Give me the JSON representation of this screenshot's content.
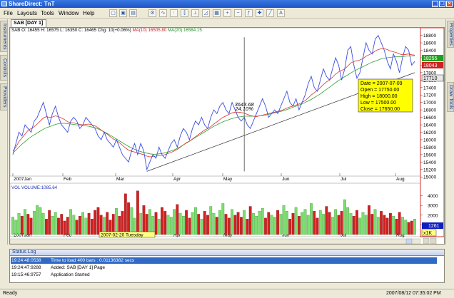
{
  "window": {
    "title": "ShareDirect: TnT"
  },
  "menu": [
    "File",
    "Layouts",
    "Tools",
    "Window",
    "Help"
  ],
  "left_tabs": [
    "Instruments",
    "Controls",
    "Providers"
  ],
  "right_tabs": [
    "Properties",
    "Draw Tools"
  ],
  "doc_tab": "SAB [DAY 1]",
  "price_header": {
    "ohlc": "SAB O: 16455 H: 16575 L: 16350 C: 16465 Chg: 10(+0.06%)",
    "ma10": "MA(10) 16505.80",
    "ma20": "MA(20) 16584.15"
  },
  "volume_header": "VOL VOLUME:1085.64",
  "annotation": {
    "points": "3643.68",
    "percent": "24.10%"
  },
  "tooltip": {
    "date": "Date = 2007-07-09",
    "open": "Open = 17750.00",
    "high": "High = 18000.00",
    "low": "Low = 17500.00",
    "close": "Close = 17650.00"
  },
  "price_badges": {
    "a": "18255",
    "b": "18043",
    "c": "17710"
  },
  "volume_badges": {
    "value": "1261",
    "multiplier": "x1K"
  },
  "cursor_date": "2007-02-20 Tuesday",
  "colors": {
    "price": "#3a4fe0",
    "ma10": "#e03030",
    "ma20": "#30a030",
    "vol_up": "#7ddc6e",
    "vol_down": "#d02020"
  },
  "chart_data": {
    "type": "line",
    "x_labels": [
      "2007Jan",
      "Feb",
      "Mar",
      "Apr",
      "May",
      "Jun",
      "Jul",
      "Aug"
    ],
    "price_ticks": [
      18800,
      18600,
      18400,
      18200,
      18000,
      17800,
      17600,
      17400,
      17200,
      17000,
      16800,
      16600,
      16400,
      16200,
      16000,
      15800,
      15600,
      15400,
      15200,
      15000
    ],
    "price_ylim": [
      15100,
      18850
    ],
    "vol_ticks": [
      "4000",
      "3000",
      "2000",
      "1000"
    ],
    "vol_ylim": [
      0,
      4700
    ],
    "series": [
      {
        "name": "SAB",
        "values": [
          15600,
          15900,
          16200,
          16100,
          16400,
          16300,
          16200,
          16500,
          16600,
          16800,
          17000,
          16700,
          16400,
          16700,
          16900,
          16600,
          16400,
          16300,
          16200,
          16500,
          16600,
          16500,
          16300,
          16400,
          16600,
          16500,
          16400,
          16300,
          16100,
          16000,
          16200,
          16000,
          15900,
          15800,
          16000,
          15800,
          15600,
          15500,
          15400,
          15700,
          15900,
          15600,
          15900,
          15700,
          15200,
          15400,
          15600,
          15500,
          15800,
          15600,
          15500,
          15700,
          15900,
          16000,
          15800,
          16100,
          16300,
          16200,
          16000,
          16300,
          16500,
          16400,
          16600,
          16400,
          16300,
          16600,
          16800,
          16700,
          16900,
          17000,
          16800,
          16700,
          17000,
          16800,
          16600,
          16500,
          16600,
          16400,
          16300,
          16500,
          16700,
          16900,
          17100,
          16900,
          16600,
          16700,
          16800,
          16700,
          16900,
          17100,
          17300,
          17000,
          16900,
          17100,
          16800,
          17000,
          17200,
          17500,
          17700,
          17400,
          17300,
          17600,
          17900,
          17700,
          17600,
          17900,
          18200,
          18000,
          17600,
          17900,
          18400,
          18500,
          18000,
          17650,
          17800,
          18200,
          18600,
          18400,
          18300,
          18700,
          18800,
          18600,
          18400,
          18100,
          17900,
          18300,
          18100,
          17800,
          18200,
          18500,
          18400,
          18000,
          18100
        ]
      },
      {
        "name": "MA(10)",
        "values": [
          15700,
          15800,
          15950,
          16050,
          16150,
          16250,
          16300,
          16350,
          16420,
          16500,
          16580,
          16620,
          16600,
          16610,
          16640,
          16620,
          16580,
          16540,
          16480,
          16460,
          16450,
          16430,
          16410,
          16400,
          16410,
          16420,
          16400,
          16370,
          16320,
          16260,
          16200,
          16150,
          16080,
          16020,
          15980,
          15920,
          15850,
          15780,
          15720,
          15690,
          15670,
          15640,
          15620,
          15600,
          15560,
          15540,
          15550,
          15560,
          15570,
          15580,
          15600,
          15630,
          15660,
          15700,
          15740,
          15800,
          15860,
          15920,
          15960,
          16020,
          16080,
          16140,
          16200,
          16260,
          16300,
          16350,
          16420,
          16480,
          16540,
          16600,
          16640,
          16680,
          16720,
          16740,
          16740,
          16730,
          16710,
          16680,
          16650,
          16630,
          16620,
          16640,
          16660,
          16680,
          16700,
          16720,
          16740,
          16760,
          16780,
          16810,
          16850,
          16880,
          16900,
          16930,
          16960,
          17000,
          17050,
          17120,
          17200,
          17260,
          17320,
          17400,
          17480,
          17550,
          17600,
          17680,
          17760,
          17820,
          17860,
          17900,
          17980,
          18060,
          18100,
          18120,
          18140,
          18180,
          18240,
          18280,
          18320,
          18380,
          18420,
          18440,
          18440,
          18420,
          18380,
          18360,
          18340,
          18300,
          18280,
          18290,
          18300,
          18280,
          18270
        ]
      },
      {
        "name": "MA(20)",
        "values": [
          15650,
          15720,
          15800,
          15880,
          15950,
          16020,
          16080,
          16130,
          16180,
          16230,
          16280,
          16320,
          16350,
          16380,
          16410,
          16430,
          16440,
          16440,
          16430,
          16420,
          16410,
          16400,
          16390,
          16380,
          16370,
          16360,
          16340,
          16320,
          16290,
          16250,
          16210,
          16170,
          16120,
          16070,
          16020,
          15970,
          15920,
          15870,
          15820,
          15780,
          15740,
          15710,
          15680,
          15660,
          15640,
          15620,
          15610,
          15610,
          15620,
          15630,
          15650,
          15670,
          15700,
          15730,
          15770,
          15810,
          15860,
          15910,
          15960,
          16010,
          16060,
          16110,
          16160,
          16210,
          16260,
          16310,
          16360,
          16400,
          16440,
          16480,
          16510,
          16540,
          16570,
          16590,
          16610,
          16620,
          16630,
          16630,
          16630,
          16630,
          16630,
          16640,
          16650,
          16660,
          16680,
          16700,
          16720,
          16740,
          16760,
          16780,
          16810,
          16840,
          16870,
          16900,
          16930,
          16960,
          17000,
          17040,
          17080,
          17130,
          17180,
          17230,
          17290,
          17350,
          17410,
          17470,
          17530,
          17590,
          17640,
          17690,
          17740,
          17790,
          17840,
          17880,
          17920,
          17960,
          18000,
          18040,
          18080,
          18110,
          18140,
          18170,
          18190,
          18200,
          18210,
          18220,
          18230,
          18230,
          18230,
          18240,
          18250,
          18250,
          18255
        ]
      },
      {
        "name": "VOL",
        "values": [
          1800,
          1500,
          2200,
          1900,
          2600,
          2100,
          1700,
          2400,
          3000,
          2800,
          2200,
          1600,
          2500,
          1900,
          2300,
          1700,
          2100,
          1400,
          1800,
          2600,
          2000,
          1500,
          1900,
          2300,
          1700,
          2200,
          1600,
          2500,
          2800,
          2000,
          1800,
          2300,
          1500,
          2100,
          2700,
          1900,
          2400,
          4200,
          3300,
          2800,
          1700,
          4500,
          2200,
          3000,
          2100,
          2600,
          1900,
          2300,
          1600,
          2800,
          2400,
          2000,
          1800,
          2600,
          3100,
          2200,
          1900,
          2500,
          1700,
          2300,
          2800,
          2100,
          1600,
          2400,
          2000,
          2900,
          2200,
          1800,
          2500,
          3200,
          2100,
          1700,
          2600,
          2000,
          2300,
          1800,
          2500,
          1600,
          2900,
          2200,
          1900,
          2400,
          2700,
          1700,
          2300,
          2000,
          1800,
          2500,
          2100,
          3000,
          2400,
          1600,
          2200,
          2800,
          1900,
          2300,
          2600,
          2000,
          3200,
          2400,
          1700,
          2500,
          2100,
          2900,
          2300,
          1800,
          2600,
          2000,
          2400,
          3600,
          2800,
          2200,
          1900,
          2500,
          1700,
          2300,
          2000,
          3000,
          2100,
          2600,
          1800,
          2400,
          2000,
          1700,
          2200,
          1900,
          1600,
          2300,
          1800,
          1500,
          1261,
          1400,
          1600
        ]
      }
    ],
    "trendline": {
      "x": [
        44,
        132
      ],
      "y": [
        15150,
        17800
      ]
    },
    "annotation_x": 76
  }
}
